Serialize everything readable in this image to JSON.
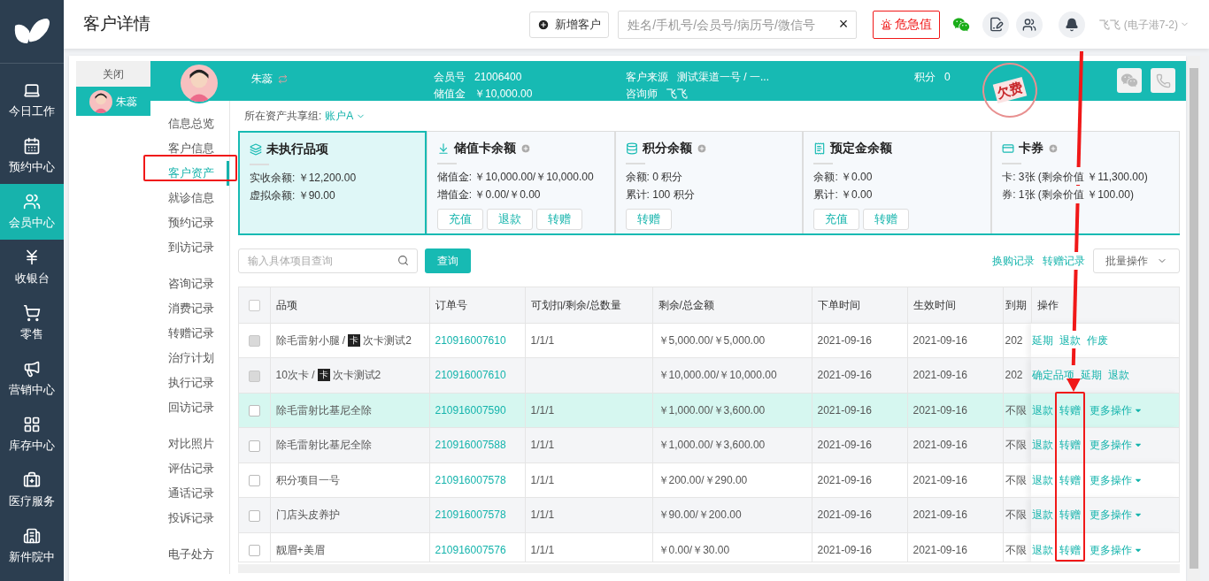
{
  "sidebar": {
    "items": [
      {
        "label": "今日工作",
        "selected": false
      },
      {
        "label": "预约中心",
        "selected": false
      },
      {
        "label": "会员中心",
        "selected": true
      },
      {
        "label": "收银台",
        "selected": false
      },
      {
        "label": "零售",
        "selected": false
      },
      {
        "label": "营销中心",
        "selected": false
      },
      {
        "label": "库存中心",
        "selected": false
      },
      {
        "label": "医疗服务",
        "selected": false
      },
      {
        "label": "新件院中",
        "selected": false
      }
    ]
  },
  "topbar": {
    "title": "客户详情",
    "new_button": "新增客户",
    "search": {
      "placeholder": "姓名/手机号/会员号/病历号/微信号",
      "clear": "×"
    },
    "alert_button": "危急值",
    "user": "飞飞 (电子港7-2)"
  },
  "customer_tabs": {
    "close": "关闭",
    "items": [
      {
        "name": "朱蕊",
        "selected": true
      }
    ]
  },
  "profile": {
    "name": "朱蕊",
    "stamp": "欠费",
    "fields": [
      {
        "label": "会员号",
        "value": "21006400"
      },
      {
        "label": "储值金",
        "value": "￥10,000.00"
      },
      {
        "label": "客户来源",
        "value": "测试渠道一号 / 一..."
      },
      {
        "label": "咨询师",
        "value": "飞飞"
      },
      {
        "label": "积分",
        "value": "0"
      }
    ]
  },
  "subnav": {
    "groups": [
      {
        "items": [
          {
            "label": "信息总览",
            "selected": false
          },
          {
            "label": "客户信息",
            "selected": false
          },
          {
            "label": "客户资产",
            "selected": true
          },
          {
            "label": "就诊信息",
            "selected": false
          },
          {
            "label": "预约记录",
            "selected": false
          },
          {
            "label": "到访记录",
            "selected": false
          }
        ]
      },
      {
        "items": [
          {
            "label": "咨询记录",
            "selected": false
          },
          {
            "label": "消费记录",
            "selected": false
          },
          {
            "label": "转赠记录",
            "selected": false
          },
          {
            "label": "治疗计划",
            "selected": false
          },
          {
            "label": "执行记录",
            "selected": false
          },
          {
            "label": "回访记录",
            "selected": false
          }
        ]
      },
      {
        "items": [
          {
            "label": "对比照片",
            "selected": false
          },
          {
            "label": "评估记录",
            "selected": false
          },
          {
            "label": "通话记录",
            "selected": false
          },
          {
            "label": "投诉记录",
            "selected": false
          }
        ]
      },
      {
        "items": [
          {
            "label": "电子处方",
            "selected": false
          }
        ]
      }
    ]
  },
  "asset_group": {
    "label": "所在资产共享组:",
    "value": "账户A"
  },
  "cards": [
    {
      "title": "未执行品项",
      "selected": true,
      "add_icon": false,
      "lines": [
        "实收余额: ￥12,200.00",
        "虚拟余额: ￥90.00"
      ]
    },
    {
      "title": "储值卡余额",
      "selected": false,
      "add_icon": true,
      "lines": [
        "储值金: ￥10,000.00/￥10,000.00",
        "增值金: ￥0.00/￥0.00"
      ],
      "buttons": [
        "充值",
        "退款",
        "转赠"
      ]
    },
    {
      "title": "积分余额",
      "selected": false,
      "add_icon": true,
      "lines": [
        "余额: 0 积分",
        "累计: 100 积分"
      ],
      "buttons": [
        "转赠"
      ]
    },
    {
      "title": "预定金余额",
      "selected": false,
      "add_icon": false,
      "lines": [
        "余额: ￥0.00",
        "累计: ￥0.00"
      ],
      "buttons": [
        "充值",
        "转赠"
      ]
    },
    {
      "title": "卡券",
      "selected": false,
      "add_icon": true,
      "lines": [
        "卡: 3张 (剩余价值 ￥11,300.00)",
        "券: 1张 (剩余价值 ￥100.00)"
      ]
    }
  ],
  "toolbar": {
    "search_placeholder": "输入具体项目查询",
    "search_button": "查询",
    "links": [
      "换购记录",
      "转赠记录"
    ],
    "batch_dropdown": "批量操作"
  },
  "table": {
    "select_all": {
      "checked": false
    },
    "columns": [
      "品项",
      "订单号",
      "可划扣/剩余/总数量",
      "剩余/总金额",
      "下单时间",
      "生效时间",
      "到期",
      "操作"
    ],
    "rows": [
      {
        "item": "除毛雷射小腿 /",
        "tag": "卡",
        "item_suffix": "次卡测试2",
        "order": "210916007610",
        "quantity": "1/1/1",
        "amount": "￥5,000.00/￥5,000.00",
        "ordered": "2021-09-16",
        "effective": "2021-09-16",
        "expiry": "202",
        "highlighted": false,
        "checkbox_disabled": true,
        "actions": [
          {
            "label": "延期",
            "kind": "link"
          },
          {
            "label": "退款",
            "kind": "link"
          },
          {
            "label": "作废",
            "kind": "link"
          }
        ]
      },
      {
        "item": "10次卡 /",
        "tag": "卡",
        "item_suffix": "次卡测试2",
        "order": "210916007610",
        "amount": "￥10,000.00/￥10,000.00",
        "ordered": "2021-09-16",
        "effective": "2021-09-16",
        "expiry": "202",
        "highlighted": false,
        "checkbox_disabled": true,
        "actions": [
          {
            "label": "确定品项",
            "kind": "link"
          },
          {
            "label": "延期",
            "kind": "link"
          },
          {
            "label": "退款",
            "kind": "link"
          }
        ]
      },
      {
        "item": "除毛雷射比基尼全除",
        "order": "210916007590",
        "quantity": "1/1/1",
        "amount": "￥1,000.00/￥3,600.00",
        "ordered": "2021-09-16",
        "effective": "2021-09-16",
        "expiry": "不限",
        "highlighted": true,
        "checkbox_disabled": false,
        "actions": [
          {
            "label": "退款",
            "kind": "link"
          },
          {
            "label": "转赠",
            "kind": "link"
          },
          {
            "label": "更多操作",
            "kind": "dropdown"
          }
        ]
      },
      {
        "item": "除毛雷射比基尼全除",
        "order": "210916007588",
        "quantity": "1/1/1",
        "amount": "￥1,000.00/￥3,600.00",
        "ordered": "2021-09-16",
        "effective": "2021-09-16",
        "expiry": "不限",
        "highlighted": false,
        "checkbox_disabled": false,
        "actions": [
          {
            "label": "退款",
            "kind": "link"
          },
          {
            "label": "转赠",
            "kind": "link"
          },
          {
            "label": "更多操作",
            "kind": "dropdown"
          }
        ]
      },
      {
        "item": "积分项目一号",
        "order": "210916007578",
        "quantity": "1/1/1",
        "amount": "￥200.00/￥290.00",
        "ordered": "2021-09-16",
        "effective": "2021-09-16",
        "expiry": "不限",
        "highlighted": false,
        "checkbox_disabled": false,
        "actions": [
          {
            "label": "退款",
            "kind": "link"
          },
          {
            "label": "转赠",
            "kind": "link"
          },
          {
            "label": "更多操作",
            "kind": "dropdown"
          }
        ]
      },
      {
        "item": "门店头皮养护",
        "order": "210916007578",
        "quantity": "1/1/1",
        "amount": "￥90.00/￥200.00",
        "ordered": "2021-09-16",
        "effective": "2021-09-16",
        "expiry": "不限",
        "highlighted": false,
        "checkbox_disabled": false,
        "actions": [
          {
            "label": "退款",
            "kind": "link"
          },
          {
            "label": "转赠",
            "kind": "link"
          },
          {
            "label": "更多操作",
            "kind": "dropdown"
          }
        ]
      },
      {
        "item": "靓眉+美眉",
        "order": "210916007576",
        "quantity": "1/1/1",
        "amount": "￥0.00/￥30.00",
        "ordered": "2021-09-16",
        "effective": "2021-09-16",
        "expiry": "不限",
        "highlighted": false,
        "checkbox_disabled": false,
        "actions": [
          {
            "label": "退款",
            "kind": "link"
          },
          {
            "label": "转赠",
            "kind": "link"
          },
          {
            "label": "更多操作",
            "kind": "dropdown"
          }
        ]
      }
    ]
  }
}
